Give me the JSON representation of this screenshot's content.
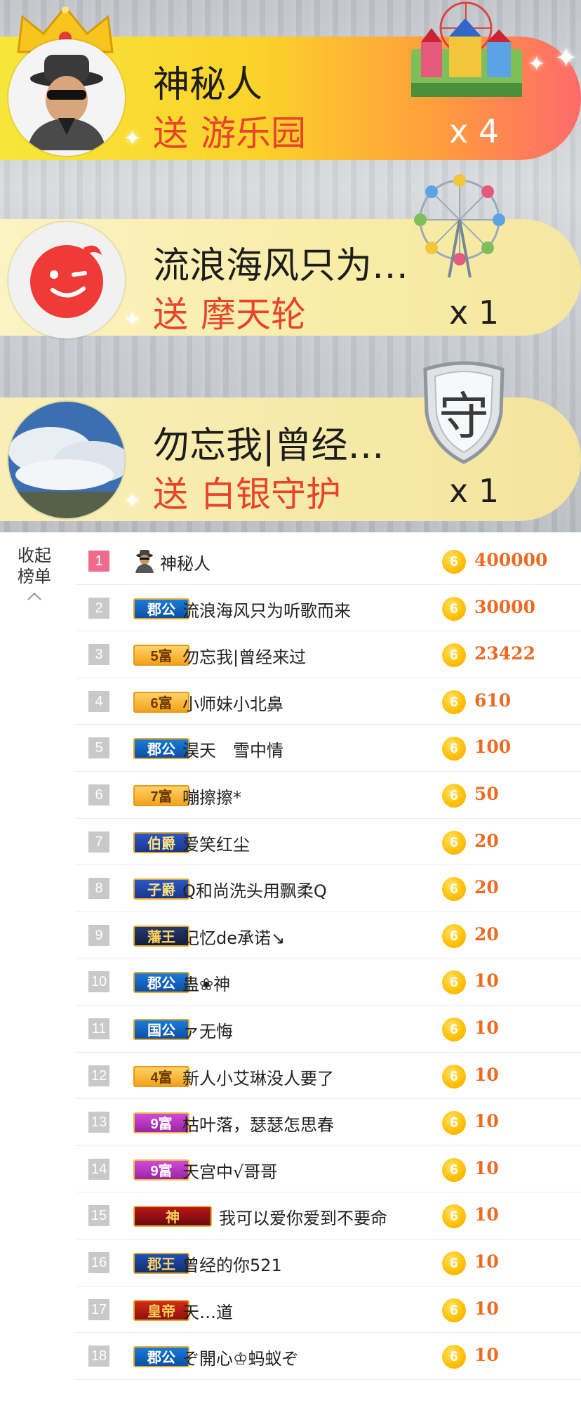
{
  "gift_feed": [
    {
      "user": "神秘人",
      "send_word": "送",
      "gift": "游乐园",
      "count": "x 4",
      "avatar": "mystery-man-avatar",
      "gift_icon": "amusement-park-icon"
    },
    {
      "user": "流浪海风只为…",
      "send_word": "送",
      "gift": "摩天轮",
      "count": "x 1",
      "avatar": "wink-face-avatar",
      "gift_icon": "ferris-wheel-icon"
    },
    {
      "user": "勿忘我|曾经…",
      "send_word": "送",
      "gift": "白银守护",
      "count": "x 1",
      "avatar": "sky-photo-avatar",
      "gift_icon": "silver-guard-shield-icon",
      "gift_icon_glyph": "守"
    }
  ],
  "collapse": {
    "label": "收起榜单",
    "icon": "chevron-up-icon"
  },
  "coin_glyph": "6",
  "colors": {
    "score": "#ec6a22",
    "first_rank_bg": "#f06a8e",
    "rank_bg": "#c9c9c9",
    "send_text": "#e8432b"
  },
  "ranking": [
    {
      "rank": "1",
      "badge": "",
      "name": "神秘人",
      "score": "400000"
    },
    {
      "rank": "2",
      "badge": "郡公",
      "name": "流浪海风只为听歌而来",
      "score": "30000"
    },
    {
      "rank": "3",
      "badge": "5富",
      "name": "勿忘我|曾经来过",
      "score": "23422"
    },
    {
      "rank": "4",
      "badge": "6富",
      "name": "小师妹小北鼻",
      "score": "610"
    },
    {
      "rank": "5",
      "badge": "郡公",
      "name": "淏天　雪中情",
      "score": "100"
    },
    {
      "rank": "6",
      "badge": "7富",
      "name": "嘣擦擦*",
      "score": "50"
    },
    {
      "rank": "7",
      "badge": "伯爵",
      "name": "爱笑红尘",
      "score": "20"
    },
    {
      "rank": "8",
      "badge": "子爵",
      "name": "Q和尚洗头用飘柔Q",
      "score": "20"
    },
    {
      "rank": "9",
      "badge": "藩王",
      "name": "记忆de承诺↘",
      "score": "20"
    },
    {
      "rank": "10",
      "badge": "郡公",
      "name": "蛊❀神",
      "score": "10"
    },
    {
      "rank": "11",
      "badge": "国公",
      "name": "ァ无悔",
      "score": "10"
    },
    {
      "rank": "12",
      "badge": "4富",
      "name": "新人小艾琳没人要了",
      "score": "10"
    },
    {
      "rank": "13",
      "badge": "9富",
      "name": "枯叶落，瑟瑟怎思春",
      "score": "10"
    },
    {
      "rank": "14",
      "badge": "9富",
      "name": "天宫中√哥哥",
      "score": "10"
    },
    {
      "rank": "15",
      "badge": "神",
      "name": "我可以爱你爱到不要命",
      "score": "10"
    },
    {
      "rank": "16",
      "badge": "郡王",
      "name": "曾经的你521",
      "score": "10"
    },
    {
      "rank": "17",
      "badge": "皇帝",
      "name": "天…道",
      "score": "10"
    },
    {
      "rank": "18",
      "badge": "郡公",
      "name": "ぞ開心♔蚂蚁ぞ",
      "score": "10"
    }
  ]
}
